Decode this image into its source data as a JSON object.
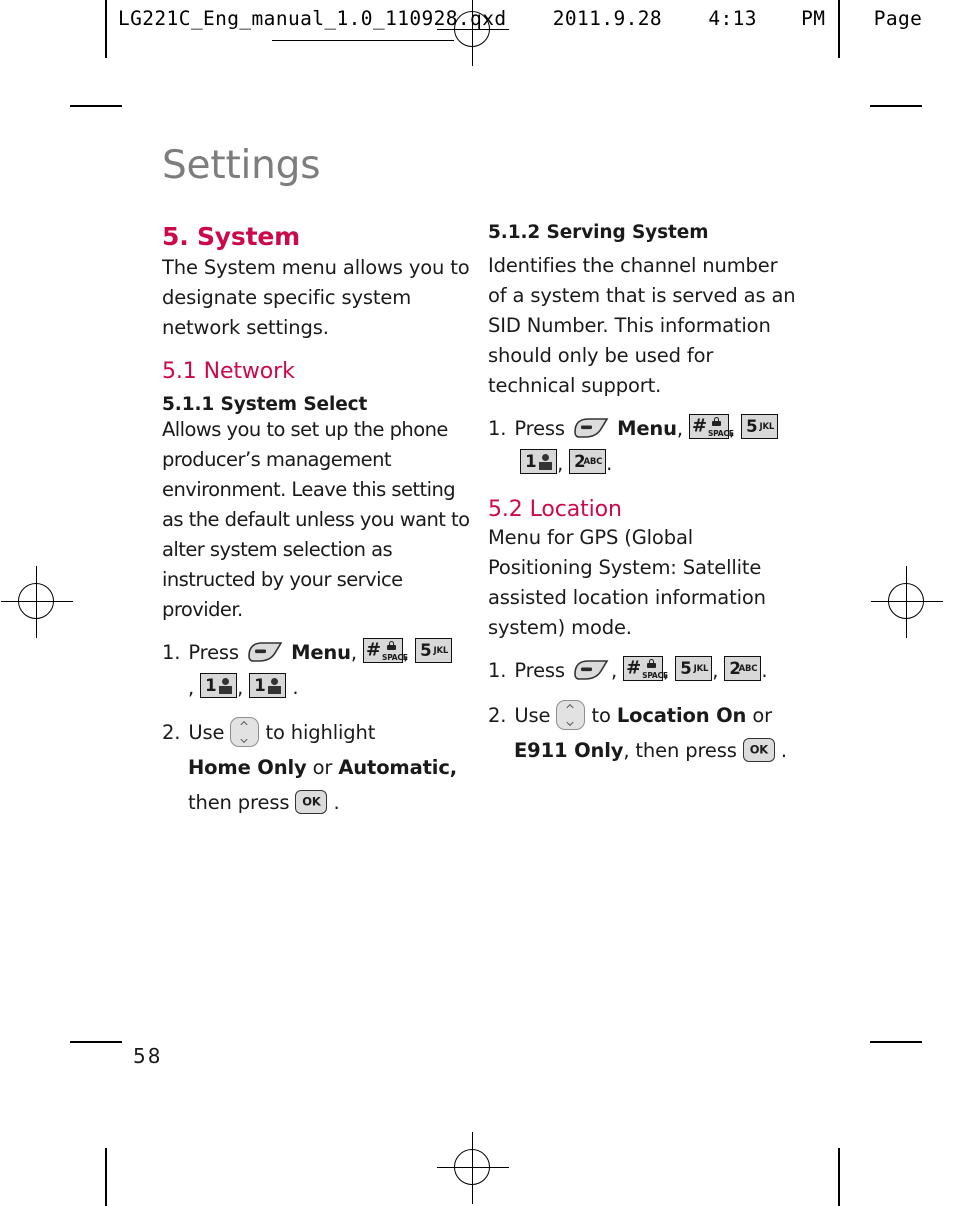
{
  "prepress": {
    "header_line": "LG221C_Eng_manual_1.0_110928.qxd  2011.9.28  4:13 PM  Page",
    "header_filename": "LG221C_Eng_manual_1.0_110928.qxd",
    "header_date": "2011.9.28",
    "header_time": "4:13",
    "header_ampm": "PM",
    "header_page_word": "Page"
  },
  "page": {
    "title": "Settings",
    "number": "58"
  },
  "left_column": {
    "section_heading": "5. System",
    "section_intro": "The System menu allows you to designate specific system network settings.",
    "subsection_heading": "5.1 Network",
    "topic_heading": "5.1.1 System Select",
    "topic_body": "Allows you to set up the phone producer’s management environment. Leave this setting as the default unless you want to alter system selection as instructed by your service provider.",
    "steps": [
      {
        "number": "1.",
        "verb": "Press",
        "menu_label": "Menu",
        "sep_comma": ",",
        "period": "."
      },
      {
        "number": "2.",
        "verb": "Use",
        "mid_text": "to highlight",
        "option_a": "Home Only",
        "conjunction": "or",
        "option_b": "Automatic,",
        "then_text": "then press",
        "period": "."
      }
    ]
  },
  "right_column": {
    "topic_heading": "5.1.2 Serving System",
    "topic_body": "Identifies the channel number of a system that is served as an SID Number. This information should only be used for technical support.",
    "step1": {
      "number": "1.",
      "verb": "Press",
      "menu_label": "Menu",
      "period": "."
    },
    "subsection_heading": "5.2 Location",
    "subsection_body": "Menu for GPS (Global Positioning System: Satellite assisted location information system) mode.",
    "steps": [
      {
        "number": "1.",
        "verb": "Press",
        "period": "."
      },
      {
        "number": "2.",
        "verb": "Use",
        "mid_text": "to",
        "option_a": "Location On",
        "conjunction": "or",
        "option_b": "E911  Only",
        "then_text": ", then press",
        "period": "."
      }
    ]
  },
  "keys": {
    "soft_key": "soft-key",
    "hash_space": "#",
    "hash_space_label": "SPACE",
    "five": "5",
    "five_letters": "JKL",
    "one": "1",
    "two": "2",
    "two_letters": "ABC",
    "ok": "OK",
    "nav": "nav-up-down"
  },
  "colors": {
    "heading_pink": "#cc0a4b",
    "title_gray": "#7d7d7d",
    "body_black": "#1a1a1a"
  }
}
